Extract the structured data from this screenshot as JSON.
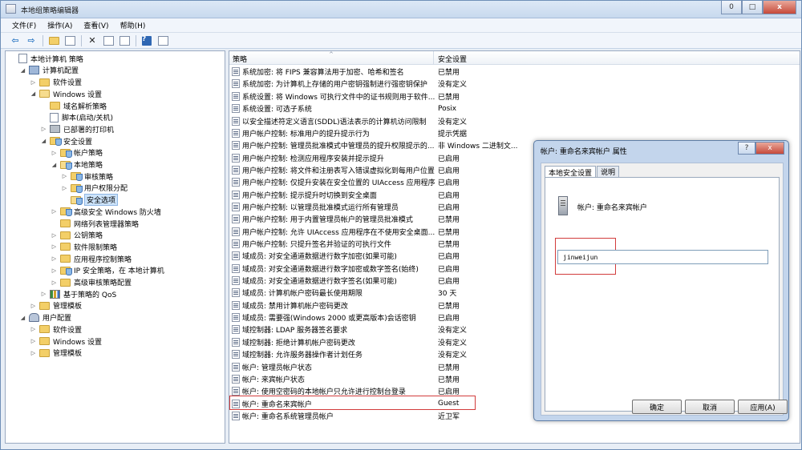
{
  "window": {
    "title": "本地组策略编辑器",
    "minimize": "0",
    "maximize": "□",
    "close": "x"
  },
  "menu": [
    "文件(F)",
    "操作(A)",
    "查看(V)",
    "帮助(H)"
  ],
  "tree": [
    {
      "label": "本地计算机 策略",
      "level": 0,
      "icon": "computer-policy-icon",
      "expander": ""
    },
    {
      "label": "计算机配置",
      "level": 1,
      "icon": "computer-icon",
      "expander": "◢"
    },
    {
      "label": "软件设置",
      "level": 2,
      "icon": "folder-icon",
      "expander": "▷"
    },
    {
      "label": "Windows 设置",
      "level": 2,
      "icon": "folder-open-icon",
      "expander": "◢"
    },
    {
      "label": "域名解析策略",
      "level": 3,
      "icon": "folder-icon",
      "expander": ""
    },
    {
      "label": "脚本(启动/关机)",
      "level": 3,
      "icon": "script-icon",
      "expander": ""
    },
    {
      "label": "已部署的打印机",
      "level": 3,
      "icon": "printer-icon",
      "expander": "▷"
    },
    {
      "label": "安全设置",
      "level": 3,
      "icon": "security-folder-icon",
      "expander": "◢"
    },
    {
      "label": "帐户策略",
      "level": 4,
      "icon": "security-folder-icon",
      "expander": "▷"
    },
    {
      "label": "本地策略",
      "level": 4,
      "icon": "security-folder-open-icon",
      "expander": "◢"
    },
    {
      "label": "审核策略",
      "level": 5,
      "icon": "security-folder-icon",
      "expander": "▷"
    },
    {
      "label": "用户权限分配",
      "level": 5,
      "icon": "security-folder-icon",
      "expander": "▷"
    },
    {
      "label": "安全选项",
      "level": 5,
      "icon": "security-folder-open-icon",
      "expander": "",
      "selected": true
    },
    {
      "label": "高级安全 Windows 防火墙",
      "level": 4,
      "icon": "security-folder-icon",
      "expander": "▷"
    },
    {
      "label": "网络列表管理器策略",
      "level": 4,
      "icon": "folder-icon",
      "expander": ""
    },
    {
      "label": "公钥策略",
      "level": 4,
      "icon": "folder-icon",
      "expander": "▷"
    },
    {
      "label": "软件限制策略",
      "level": 4,
      "icon": "folder-icon",
      "expander": "▷"
    },
    {
      "label": "应用程序控制策略",
      "level": 4,
      "icon": "folder-icon",
      "expander": "▷"
    },
    {
      "label": "IP 安全策略，在 本地计算机",
      "level": 4,
      "icon": "security-folder-icon",
      "expander": "▷"
    },
    {
      "label": "高级审核策略配置",
      "level": 4,
      "icon": "folder-icon",
      "expander": "▷"
    },
    {
      "label": "基于策略的 QoS",
      "level": 3,
      "icon": "chart-icon",
      "expander": "▷"
    },
    {
      "label": "管理模板",
      "level": 2,
      "icon": "folder-icon",
      "expander": "▷"
    },
    {
      "label": "用户配置",
      "level": 1,
      "icon": "user-config-icon",
      "expander": "◢"
    },
    {
      "label": "软件设置",
      "level": 2,
      "icon": "folder-icon",
      "expander": "▷"
    },
    {
      "label": "Windows 设置",
      "level": 2,
      "icon": "folder-icon",
      "expander": "▷"
    },
    {
      "label": "管理模板",
      "level": 2,
      "icon": "folder-icon",
      "expander": "▷"
    }
  ],
  "list": {
    "columns": [
      "策略",
      "安全设置"
    ],
    "sort_indicator": "^",
    "rows": [
      {
        "policy": "系统加密: 将 FIPS 兼容算法用于加密、哈希和签名",
        "setting": "已禁用"
      },
      {
        "policy": "系统加密: 为计算机上存储的用户密钥强制进行强密钥保护",
        "setting": "没有定义"
      },
      {
        "policy": "系统设置: 将 Windows 可执行文件中的证书规则用于软件...",
        "setting": "已禁用"
      },
      {
        "policy": "系统设置: 可选子系统",
        "setting": "Posix"
      },
      {
        "policy": "以安全描述符定义语言(SDDL)语法表示的计算机访问限制",
        "setting": "没有定义"
      },
      {
        "policy": "用户帐户控制: 标准用户的提升提示行为",
        "setting": "提示凭据"
      },
      {
        "policy": "用户帐户控制: 管理员批准模式中管理员的提升权限提示的...",
        "setting": "非 Windows 二进制文..."
      },
      {
        "policy": "用户帐户控制: 检测应用程序安装并提示提升",
        "setting": "已启用"
      },
      {
        "policy": "用户帐户控制: 将文件和注册表写入错误虚拟化到每用户位置",
        "setting": "已启用"
      },
      {
        "policy": "用户帐户控制: 仅提升安装在安全位置的 UIAccess 应用程序",
        "setting": "已启用"
      },
      {
        "policy": "用户帐户控制: 提示提升时切换到安全桌面",
        "setting": "已启用"
      },
      {
        "policy": "用户帐户控制: 以管理员批准模式运行所有管理员",
        "setting": "已启用"
      },
      {
        "policy": "用户帐户控制: 用于内置管理员帐户的管理员批准模式",
        "setting": "已禁用"
      },
      {
        "policy": "用户帐户控制: 允许 UIAccess 应用程序在不使用安全桌面...",
        "setting": "已禁用"
      },
      {
        "policy": "用户帐户控制: 只提升签名并验证的可执行文件",
        "setting": "已禁用"
      },
      {
        "policy": "域成员: 对安全通道数据进行数字加密(如果可能)",
        "setting": "已启用"
      },
      {
        "policy": "域成员: 对安全通道数据进行数字加密或数字签名(始终)",
        "setting": "已启用"
      },
      {
        "policy": "域成员: 对安全通道数据进行数字签名(如果可能)",
        "setting": "已启用"
      },
      {
        "policy": "域成员: 计算机帐户密码最长使用期限",
        "setting": "30 天"
      },
      {
        "policy": "域成员: 禁用计算机帐户密码更改",
        "setting": "已禁用"
      },
      {
        "policy": "域成员: 需要强(Windows 2000 或更高版本)会话密钥",
        "setting": "已启用"
      },
      {
        "policy": "域控制器: LDAP 服务器签名要求",
        "setting": "没有定义"
      },
      {
        "policy": "域控制器: 拒绝计算机帐户密码更改",
        "setting": "没有定义"
      },
      {
        "policy": "域控制器: 允许服务器操作者计划任务",
        "setting": "没有定义"
      },
      {
        "policy": "帐户: 管理员帐户状态",
        "setting": "已禁用"
      },
      {
        "policy": "帐户: 来宾帐户状态",
        "setting": "已禁用"
      },
      {
        "policy": "帐户: 使用空密码的本地帐户只允许进行控制台登录",
        "setting": "已启用"
      },
      {
        "policy": "帐户: 重命名来宾帐户",
        "setting": "Guest",
        "highlighted": true
      },
      {
        "policy": "帐户: 重命名系统管理员帐户",
        "setting": "近卫军"
      }
    ]
  },
  "dialog": {
    "title": "帐户: 重命名来宾帐户 属性",
    "help_button": "?",
    "close_button": "x",
    "tabs": [
      "本地安全设置",
      "说明"
    ],
    "policy_title": "帐户: 重命名来宾帐户",
    "input_value": "jinweijun",
    "buttons": {
      "ok": "确定",
      "cancel": "取消",
      "apply": "应用(A)"
    }
  },
  "colors": {
    "highlight": "#d23c3c",
    "selection": "#cde4fb"
  }
}
